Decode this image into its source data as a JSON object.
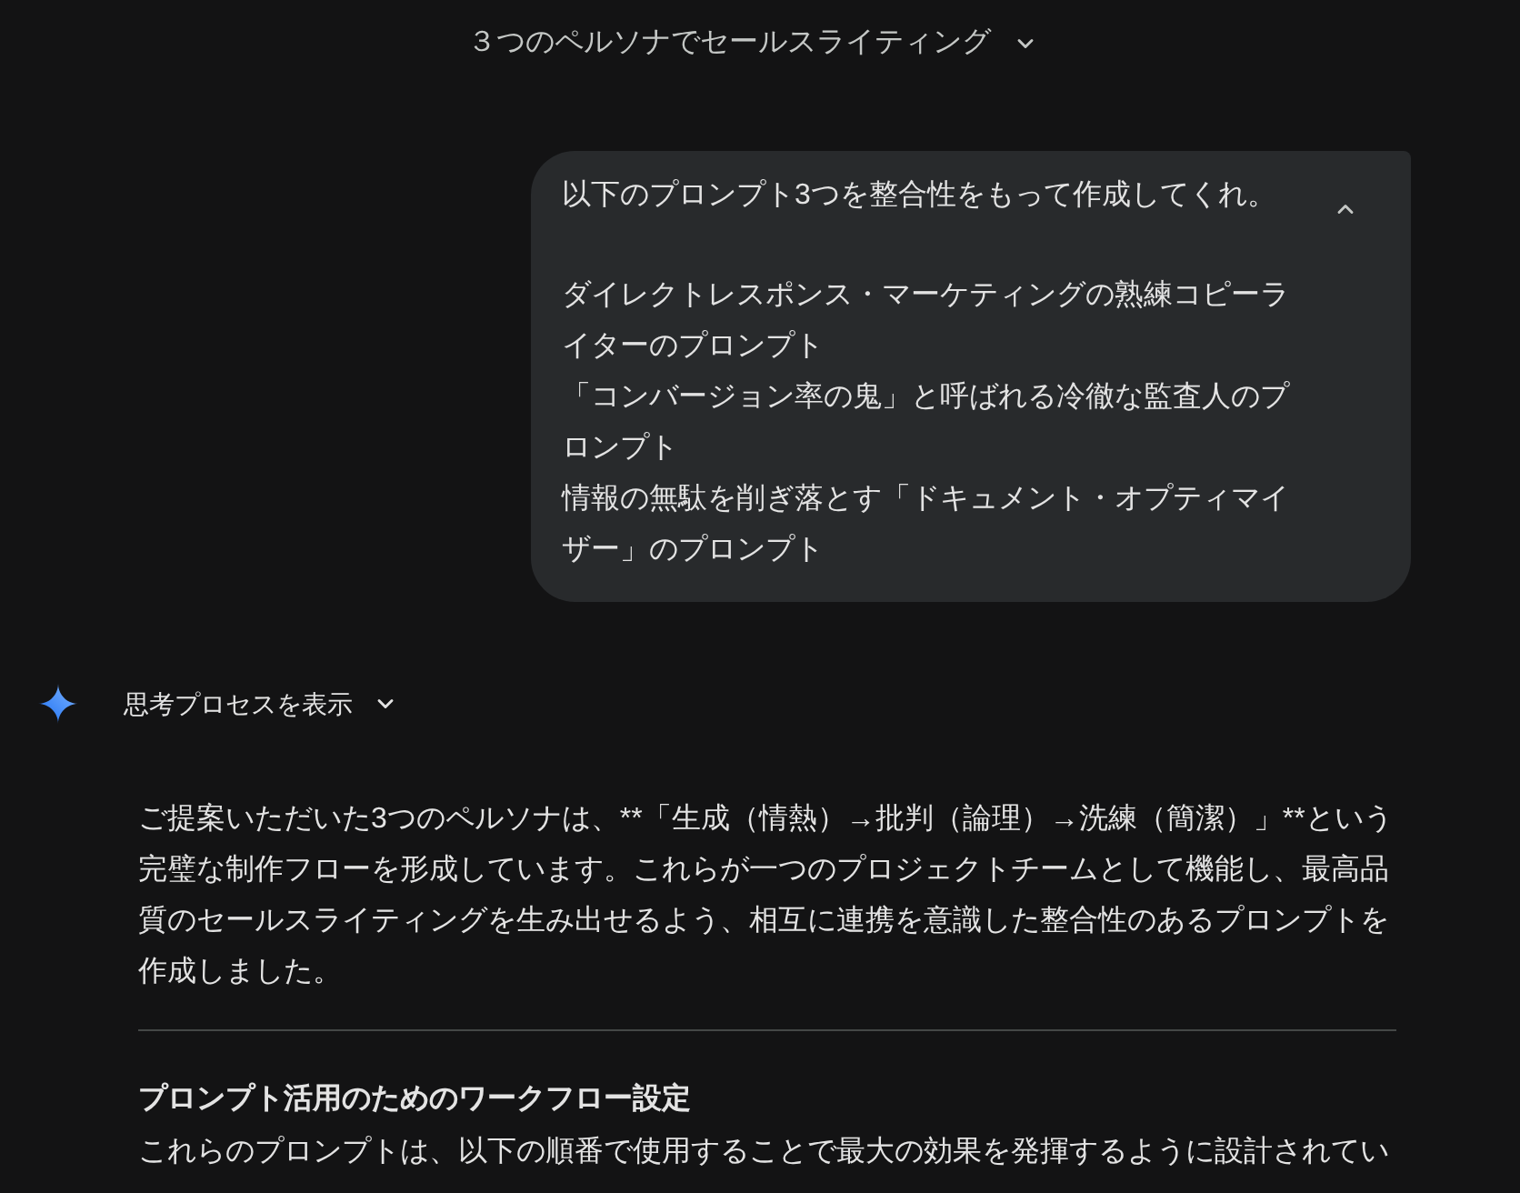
{
  "header": {
    "title": "３つのペルソナでセールスライティング"
  },
  "user_message": {
    "text": "以下のプロンプト3つを整合性をもって作成してくれ。",
    "expanded": true,
    "items": [
      "ダイレクトレスポンス・マーケティングの熟練コピーライターのプロンプト",
      "「コンバージョン率の鬼」と呼ばれる冷徹な監査人のプロンプト",
      "情報の無駄を削ぎ落とす「ドキュメント・オプティマイザー」のプロンプト"
    ]
  },
  "response": {
    "thinking_toggle": {
      "label": "思考プロセスを表示",
      "expanded": false
    },
    "blocks": [
      {
        "kind": "paragraph",
        "text": "ご提案いただいた3つのペルソナは、**「生成（情熱）→批判（論理）→洗練（簡潔）」**という完璧な制作フローを形成しています。これらが一つのプロジェクトチームとして機能し、最高品質のセールスライティングを生み出せるよう、相互に連携を意識した整合性のあるプロンプトを作成しました。"
      },
      {
        "kind": "divider"
      },
      {
        "kind": "heading",
        "text": "プロンプト活用のためのワークフロー設定"
      },
      {
        "kind": "paragraph",
        "text": "これらのプロンプトは、以下の順番で使用することで最大の効果を発揮するように設計されてい"
      }
    ]
  }
}
